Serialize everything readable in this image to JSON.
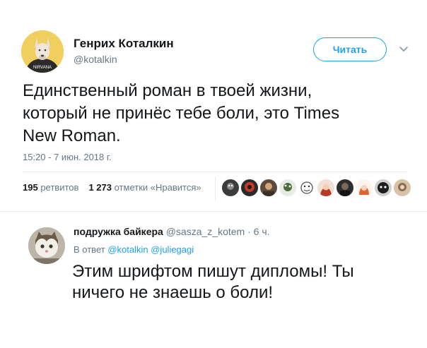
{
  "tweet": {
    "author_name": "Генрих Коталкин",
    "author_handle": "@kotalkin",
    "follow_label": "Читать",
    "text": "Единственный роман в твоей жизни,\nкоторый не принёс тебе боли, это Times\nNew Roman.",
    "timestamp": "15:20 - 7 июн. 2018 г.",
    "retweets_count": "195",
    "retweets_label": "ретвитов",
    "likes_count": "1 273",
    "likes_label": "отметки «Нравится»",
    "likers": [
      "liker-1",
      "liker-2",
      "liker-3",
      "liker-4",
      "liker-5",
      "liker-6",
      "liker-7",
      "liker-8",
      "liker-9",
      "liker-10"
    ]
  },
  "reply": {
    "author_name": "подружка байкера",
    "author_handle": "@sasza_z_kotem",
    "separator": "·",
    "time": "6 ч.",
    "reply_to_label": "В ответ",
    "mention_1": "@kotalkin",
    "mention_2": "@juliegagi",
    "text": "Этим шрифтом пишут дипломы! Ты\nничего не знаешь о боли!"
  },
  "colors": {
    "accent": "#1da1f2",
    "text_primary": "#14171a",
    "text_secondary": "#657786",
    "divider": "#e6ecf0"
  }
}
